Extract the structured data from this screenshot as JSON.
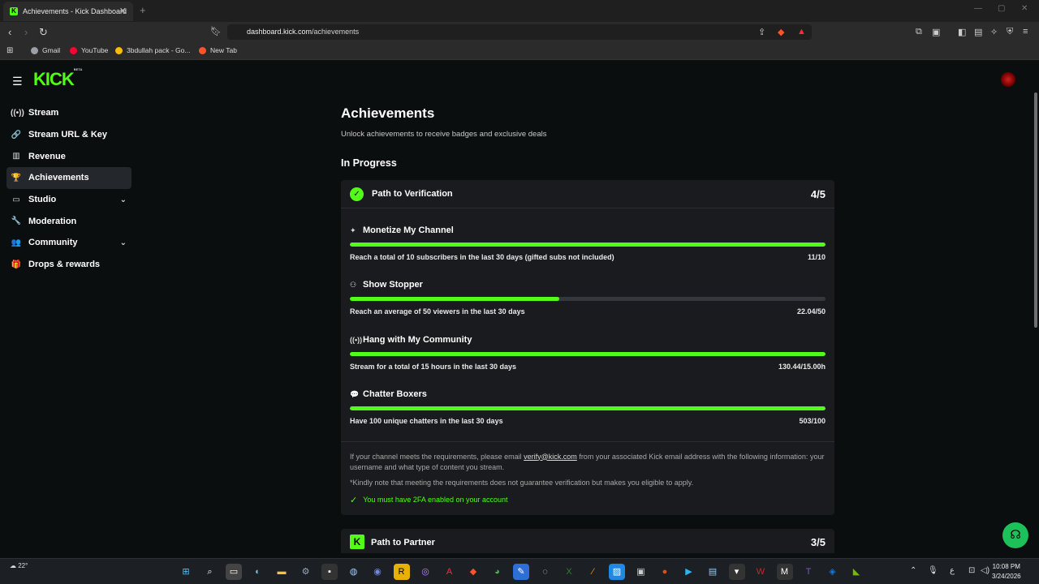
{
  "browser": {
    "tab_title": "Achievements - Kick Dashboard",
    "tab_close": "✕",
    "new_tab": "+",
    "url_host": "dashboard.kick.com",
    "url_path": "/achievements",
    "bookmarks": [
      {
        "label": "Gmail",
        "color": "#9aa0a6"
      },
      {
        "label": "YouTube",
        "color": "#ff0033"
      },
      {
        "label": "3bdullah pack - Go...",
        "color": "#fbbc04"
      },
      {
        "label": "New Tab",
        "color": "#fb542b"
      }
    ]
  },
  "app": {
    "logo": "KICK",
    "logo_tag": "BETA"
  },
  "sidebar": {
    "items": [
      {
        "label": "Stream",
        "icon": "((•))"
      },
      {
        "label": "Stream URL & Key",
        "icon": "🔗"
      },
      {
        "label": "Revenue",
        "icon": "▥"
      },
      {
        "label": "Achievements",
        "icon": "🏆"
      },
      {
        "label": "Studio",
        "icon": "▭"
      },
      {
        "label": "Moderation",
        "icon": "🔧"
      },
      {
        "label": "Community",
        "icon": "👥"
      },
      {
        "label": "Drops & rewards",
        "icon": "🎁"
      }
    ]
  },
  "main": {
    "title": "Achievements",
    "subtitle": "Unlock achievements to receive badges and exclusive deals",
    "section_title": "In Progress",
    "verification": {
      "title": "Path to Verification",
      "score": "4/5",
      "achievements": [
        {
          "name": "Monetize My Channel",
          "icon": "✦",
          "requirement": "Reach a total of 10 subscribers in the last 30 days (gifted subs not included)",
          "progress": "11/10",
          "fill_percent": 100
        },
        {
          "name": "Show Stopper",
          "icon": "⚇",
          "requirement": "Reach an average of 50 viewers in the last 30 days",
          "progress": "22.04/50",
          "fill_percent": 44
        },
        {
          "name": "Hang with My Community",
          "icon": "((•))",
          "requirement": "Stream for a total of 15 hours in the last 30 days",
          "progress": "130.44/15.00h",
          "fill_percent": 100
        },
        {
          "name": "Chatter Boxers",
          "icon": "💬",
          "requirement": "Have 100 unique chatters in the last 30 days",
          "progress": "503/100",
          "fill_percent": 100
        }
      ],
      "footer_text_1": "If your channel meets the requirements, please email",
      "footer_email": "verify@kick.com",
      "footer_text_2": "from your associated Kick email address with the following information: your username and what type of content you stream.",
      "footer_note": "*Kindly note that meeting the requirements does not guarantee verification but makes you eligible to apply.",
      "twofa": "You must have 2FA enabled on your account"
    },
    "partner": {
      "title": "Path to Partner",
      "score": "3/5"
    }
  },
  "taskbar": {
    "weather": "22°",
    "time": "10:08 PM",
    "date": "3/24/2026"
  },
  "colors": {
    "accent": "#53fc18",
    "background": "#0b0e0f",
    "card": "#191b1f"
  }
}
